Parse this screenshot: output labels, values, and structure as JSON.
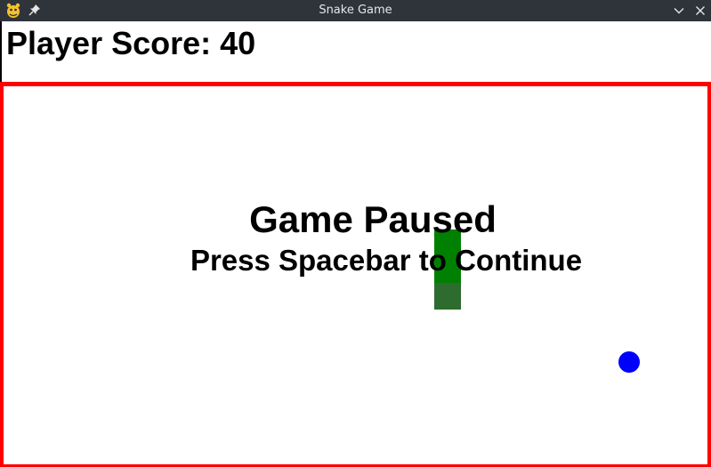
{
  "window": {
    "title": "Snake Game",
    "app_icon": "pygame-snake-icon",
    "pin_icon": "pin-icon",
    "minimize_icon": "chevron-down-icon",
    "close_icon": "close-icon",
    "titlebar_color": "#2f343b"
  },
  "hud": {
    "score_text": "Player Score: 40",
    "score_value": 40
  },
  "overlay": {
    "title": "Game Paused",
    "subtitle": "Press Spacebar to Continue"
  },
  "colors": {
    "border": "#ff0000",
    "snake_head": "#008000",
    "snake_body": "#2e6b2e",
    "food": "#0000ff",
    "text": "#000000",
    "background": "#ffffff"
  },
  "snake": {
    "segments": [
      "head",
      "body",
      "tail"
    ]
  }
}
